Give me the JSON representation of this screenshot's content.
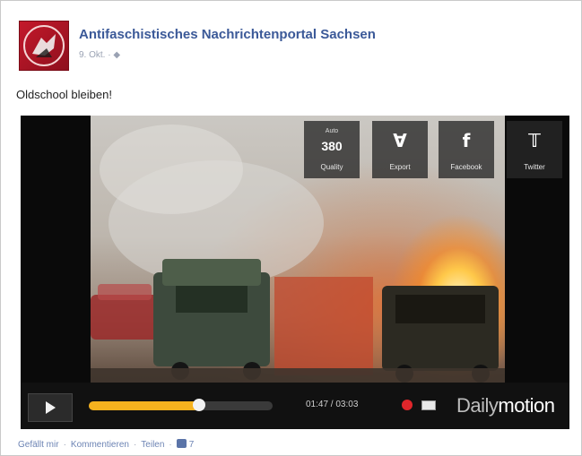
{
  "post": {
    "page_name": "Antifaschistisches Nachrichtenportal Sachsen",
    "meta": "9. Okt. · ◆",
    "text": "Oldschool bleiben!"
  },
  "player": {
    "overlay_buttons": [
      {
        "name": "quality",
        "top": "Auto",
        "main": "380",
        "label": "Quality"
      },
      {
        "name": "export",
        "label": "Export",
        "icon": "export-icon"
      },
      {
        "name": "facebook",
        "label": "Facebook",
        "icon": "facebook-icon"
      },
      {
        "name": "twitter",
        "label": "Twitter",
        "icon": "twitter-icon"
      }
    ],
    "progress_fraction": 0.6,
    "time": "01:47 / 03:03",
    "brand_light": "Daily",
    "brand_bold": "motion"
  },
  "footer": {
    "like": "Gefällt mir",
    "comment": "Kommentieren",
    "share": "Teilen",
    "like_count": "7"
  },
  "colors": {
    "link_blue": "#3b5998",
    "progress": "#f6b21e"
  }
}
